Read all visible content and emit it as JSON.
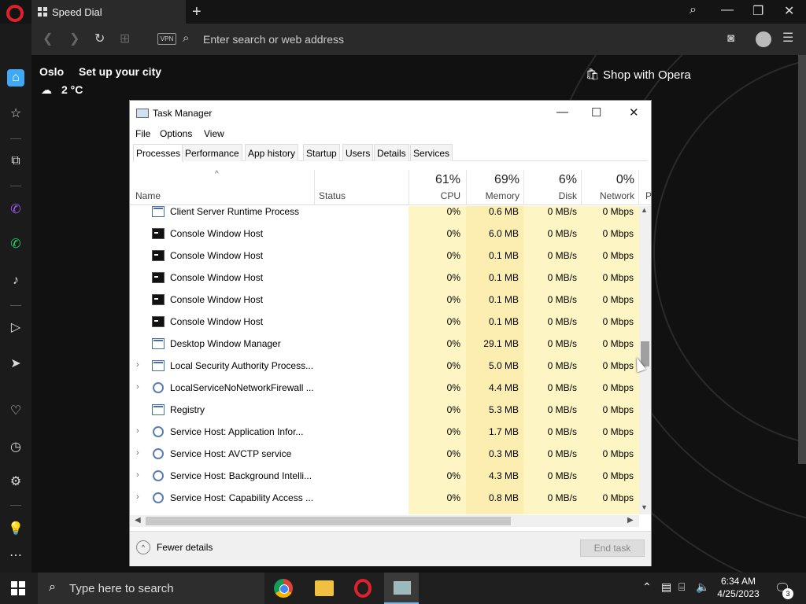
{
  "browser": {
    "tab_title": "Speed Dial",
    "address_placeholder": "Enter search or web address",
    "vpn_label": "VPN"
  },
  "weather": {
    "city": "Oslo",
    "setup_label": "Set up your city",
    "temperature": "2 °C"
  },
  "shop": {
    "label": "Shop with Opera"
  },
  "task_manager": {
    "title": "Task Manager",
    "menu": [
      "File",
      "Options",
      "View"
    ],
    "tabs": [
      "Processes",
      "Performance",
      "App history",
      "Startup",
      "Users",
      "Details",
      "Services"
    ],
    "columns": {
      "name": "Name",
      "status": "Status",
      "cpu": {
        "pct": "61%",
        "label": "CPU"
      },
      "memory": {
        "pct": "69%",
        "label": "Memory"
      },
      "disk": {
        "pct": "6%",
        "label": "Disk"
      },
      "network": {
        "pct": "0%",
        "label": "Network"
      },
      "power_partial": "P"
    },
    "rows": [
      {
        "name": "Client Server Runtime Process",
        "icon": "window-icon",
        "expandable": false,
        "cpu": "0%",
        "memory": "0.6 MB",
        "disk": "0 MB/s",
        "network": "0 Mbps"
      },
      {
        "name": "Console Window Host",
        "icon": "console-icon",
        "expandable": false,
        "cpu": "0%",
        "memory": "6.0 MB",
        "disk": "0 MB/s",
        "network": "0 Mbps"
      },
      {
        "name": "Console Window Host",
        "icon": "console-icon",
        "expandable": false,
        "cpu": "0%",
        "memory": "0.1 MB",
        "disk": "0 MB/s",
        "network": "0 Mbps"
      },
      {
        "name": "Console Window Host",
        "icon": "console-icon",
        "expandable": false,
        "cpu": "0%",
        "memory": "0.1 MB",
        "disk": "0 MB/s",
        "network": "0 Mbps"
      },
      {
        "name": "Console Window Host",
        "icon": "console-icon",
        "expandable": false,
        "cpu": "0%",
        "memory": "0.1 MB",
        "disk": "0 MB/s",
        "network": "0 Mbps"
      },
      {
        "name": "Console Window Host",
        "icon": "console-icon",
        "expandable": false,
        "cpu": "0%",
        "memory": "0.1 MB",
        "disk": "0 MB/s",
        "network": "0 Mbps"
      },
      {
        "name": "Desktop Window Manager",
        "icon": "window-icon",
        "expandable": false,
        "cpu": "0%",
        "memory": "29.1 MB",
        "disk": "0 MB/s",
        "network": "0 Mbps"
      },
      {
        "name": "Local Security Authority Process...",
        "icon": "window-icon",
        "expandable": true,
        "cpu": "0%",
        "memory": "5.0 MB",
        "disk": "0 MB/s",
        "network": "0 Mbps"
      },
      {
        "name": "LocalServiceNoNetworkFirewall ...",
        "icon": "gear-icon",
        "expandable": true,
        "cpu": "0%",
        "memory": "4.4 MB",
        "disk": "0 MB/s",
        "network": "0 Mbps"
      },
      {
        "name": "Registry",
        "icon": "window-icon",
        "expandable": false,
        "cpu": "0%",
        "memory": "5.3 MB",
        "disk": "0 MB/s",
        "network": "0 Mbps"
      },
      {
        "name": "Service Host: Application Infor...",
        "icon": "gear-icon",
        "expandable": true,
        "cpu": "0%",
        "memory": "1.7 MB",
        "disk": "0 MB/s",
        "network": "0 Mbps"
      },
      {
        "name": "Service Host: AVCTP service",
        "icon": "gear-icon",
        "expandable": true,
        "cpu": "0%",
        "memory": "0.3 MB",
        "disk": "0 MB/s",
        "network": "0 Mbps"
      },
      {
        "name": "Service Host: Background Intelli...",
        "icon": "gear-icon",
        "expandable": true,
        "cpu": "0%",
        "memory": "4.3 MB",
        "disk": "0 MB/s",
        "network": "0 Mbps"
      },
      {
        "name": "Service Host: Capability Access ...",
        "icon": "gear-icon",
        "expandable": true,
        "cpu": "0%",
        "memory": "0.8 MB",
        "disk": "0 MB/s",
        "network": "0 Mbps"
      }
    ],
    "fewer_details": "Fewer details",
    "end_task": "End task"
  },
  "taskbar": {
    "search_placeholder": "Type here to search",
    "time": "6:34 AM",
    "date": "4/25/2023",
    "notification_count": "3"
  },
  "colors": {
    "opera_red": "#e0202a",
    "column_highlight": "#fdf5c4",
    "taskbar_bg": "#1f1f1f"
  }
}
